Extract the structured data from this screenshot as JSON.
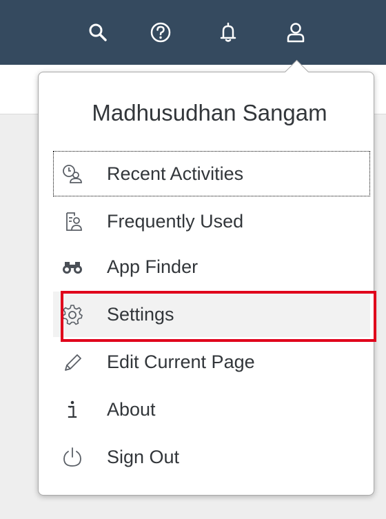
{
  "shellbar": {
    "icons": [
      "search-icon",
      "help-icon",
      "notification-bell-icon",
      "user-icon"
    ],
    "background": "#354a5f"
  },
  "user_menu": {
    "user_name": "Madhusudhan Sangam",
    "items": [
      {
        "label": "Recent Activities",
        "icon": "recent-activities-icon",
        "focused": true
      },
      {
        "label": "Frequently Used",
        "icon": "frequently-used-icon"
      },
      {
        "label": "App Finder",
        "icon": "binoculars-icon"
      },
      {
        "label": "Settings",
        "icon": "gear-icon",
        "highlighted": true
      },
      {
        "label": "Edit Current Page",
        "icon": "pencil-icon"
      },
      {
        "label": "About",
        "icon": "info-icon"
      },
      {
        "label": "Sign Out",
        "icon": "power-icon"
      }
    ]
  },
  "colors": {
    "highlight_border": "#e0001b",
    "text": "#32363a"
  }
}
